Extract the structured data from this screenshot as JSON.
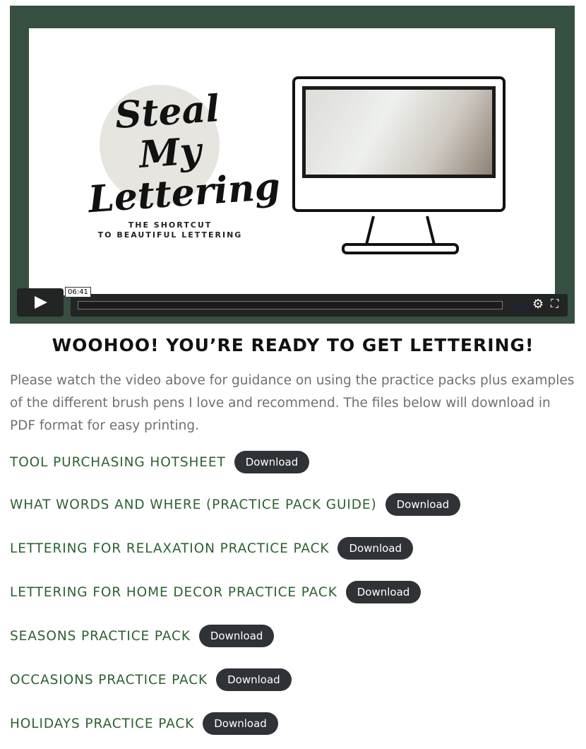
{
  "video": {
    "logo_text": "Steal My Lettering",
    "tagline_1": "THE SHORTCUT",
    "tagline_2": "TO BEAUTIFUL LETTERING",
    "time_tooltip": "06:41",
    "icons": {
      "play": "play-icon",
      "volume": "volume-icon",
      "settings": "gear-icon",
      "fullscreen": "fullscreen-icon"
    },
    "frame_color": "#354f40"
  },
  "heading": "WOOHOO! YOU’RE READY TO GET LETTERING!",
  "intro": "Please watch the video above for guidance on using the practice packs plus examples of the different brush pens I love and recommend. The files below will download in PDF format for easy printing.",
  "downloads": [
    {
      "title": "TOOL PURCHASING HOTSHEET",
      "button": "Download"
    },
    {
      "title": "WHAT WORDS AND WHERE (PRACTICE PACK GUIDE)",
      "button": "Download"
    },
    {
      "title": "LETTERING FOR RELAXATION PRACTICE PACK",
      "button": "Download"
    },
    {
      "title": "LETTERING FOR HOME DECOR PRACTICE PACK",
      "button": "Download"
    },
    {
      "title": "SEASONS PRACTICE PACK",
      "button": "Download"
    },
    {
      "title": "OCCASIONS PRACTICE PACK",
      "button": "Download"
    },
    {
      "title": "HOLIDAYS PRACTICE PACK",
      "button": "Download"
    }
  ],
  "colors": {
    "link": "#2c6230",
    "button": "#2f3236"
  }
}
